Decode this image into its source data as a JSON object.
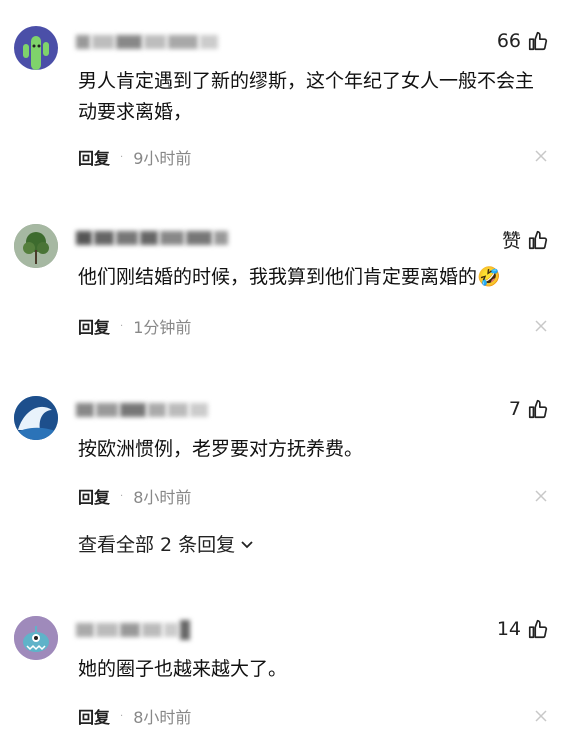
{
  "comments": [
    {
      "likes": "66",
      "text": "男人肯定遇到了新的缪斯，这个年纪了女人一般不会主动要求离婚，",
      "reply_label": "回复",
      "time": "9小时前"
    },
    {
      "likes": "赞",
      "text": "他们刚结婚的时候，我我算到他们肯定要离婚的🤣",
      "reply_label": "回复",
      "time": "1分钟前"
    },
    {
      "likes": "7",
      "text": "按欧洲惯例，老罗要对方抚养费。",
      "reply_label": "回复",
      "time": "8小时前",
      "expand_label": "查看全部 2 条回复"
    },
    {
      "likes": "14",
      "text": "她的圈子也越来越大了。",
      "reply_label": "回复",
      "time": "8小时前"
    }
  ],
  "separator": "·",
  "icons": {
    "like": "thumbs-up-icon",
    "close": "close-icon",
    "expand": "chevron-down-icon"
  },
  "colors": {
    "text": "#111111",
    "meta": "#888888",
    "close": "#c8c8c8"
  }
}
